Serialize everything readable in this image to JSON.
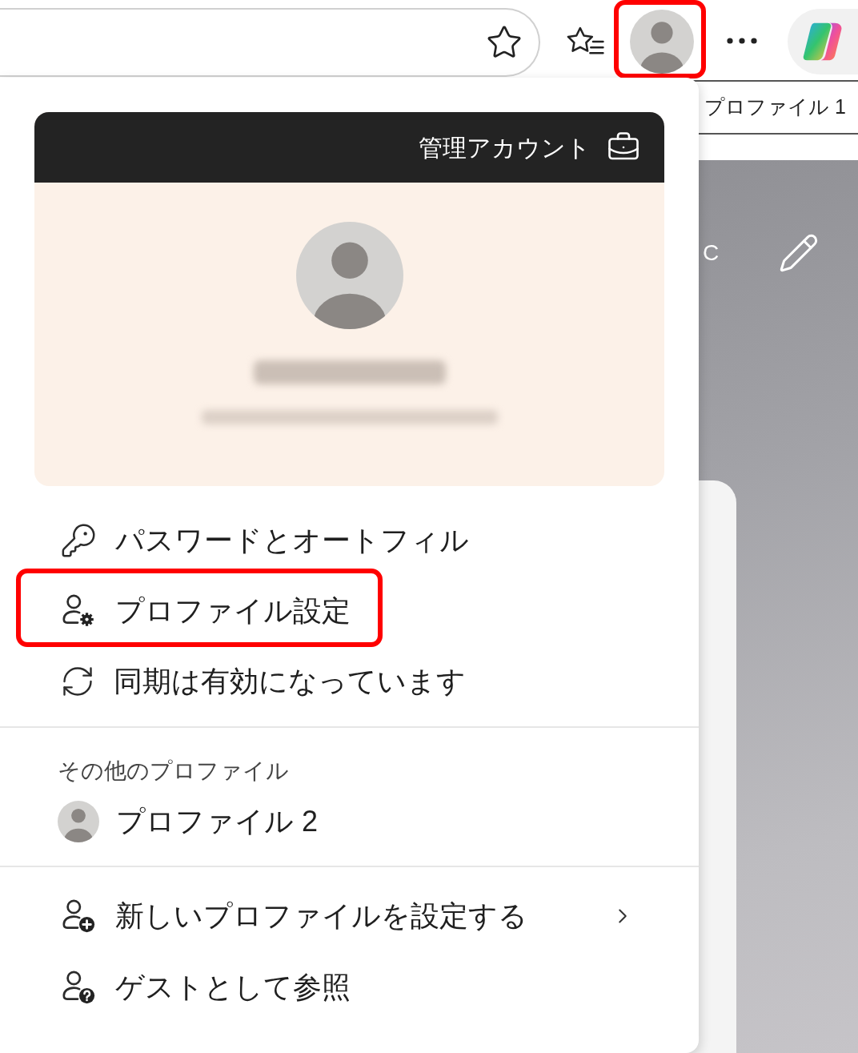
{
  "toolbar": {
    "profile_button": {
      "highlighted": true
    },
    "tooltip": "プロファイル 1"
  },
  "menu": {
    "account_badge": "管理アカウント",
    "items": [
      {
        "label": "パスワードとオートフィル",
        "highlighted": false
      },
      {
        "label": "プロファイル設定",
        "highlighted": true
      },
      {
        "label": "同期は有効になっています",
        "highlighted": false
      }
    ],
    "other_profiles": {
      "heading": "その他のプロファイル",
      "profiles": [
        {
          "name": "プロファイル 2"
        }
      ]
    },
    "actions": [
      {
        "label": "新しいプロファイルを設定する",
        "submenu": true
      },
      {
        "label": "ゲストとして参照",
        "submenu": false
      }
    ]
  },
  "page": {
    "weather_text": "C"
  }
}
